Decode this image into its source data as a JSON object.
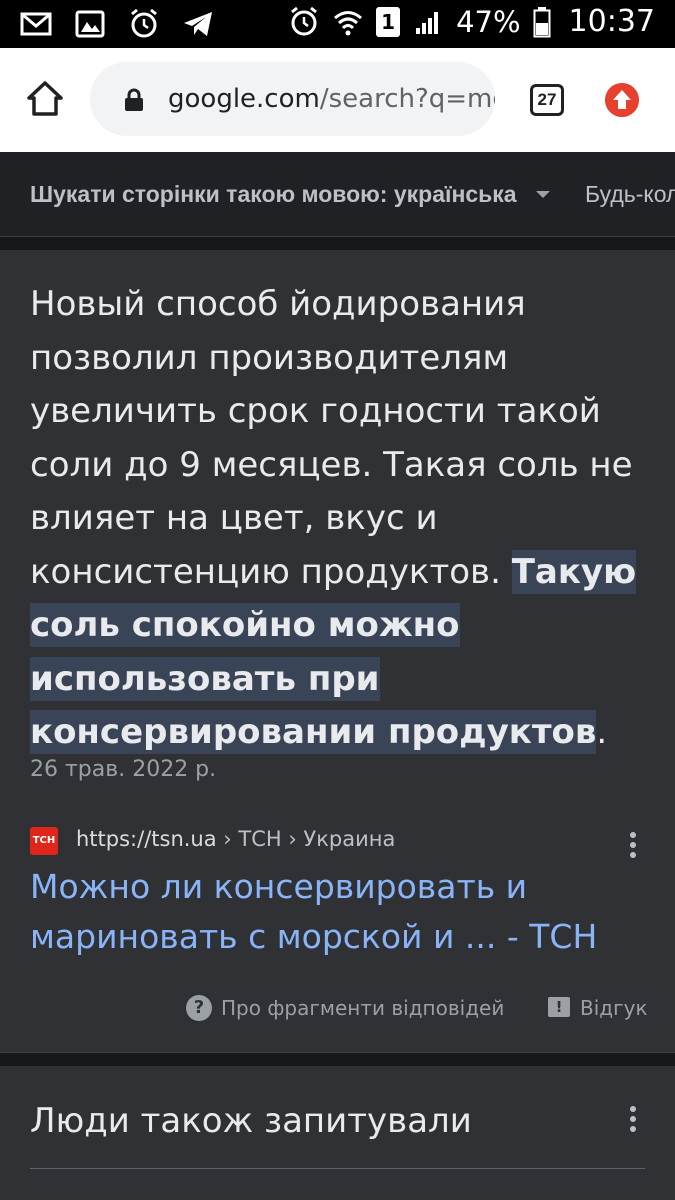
{
  "status_bar": {
    "icons_left": [
      "gmail-icon",
      "gallery-icon",
      "alarm-icon",
      "telegram-icon"
    ],
    "sim_slot": "1",
    "battery_percent": "47%",
    "time": "10:37"
  },
  "browser": {
    "url_host": "google.com",
    "url_rest": "/search?q=mo:",
    "tab_count": "27"
  },
  "language_bar": {
    "language_filter": "Шукати сторінки такою мовою: українська",
    "any_time": "Будь-коли"
  },
  "featured_snippet": {
    "text_plain": "Новый способ йодирования позволил производителям увеличить срок годности такой соли до 9 месяцев. Такая соль не влияет на цвет, вкус и консистенцию продуктов. ",
    "text_highlight": "Такую соль спокойно можно использовать при консервировании продуктов",
    "text_tail": ".",
    "date": "26 трав. 2022 р.",
    "source_logo_text": "ТСН",
    "source_url": "https://tsn.ua",
    "source_breadcrumb": " › ТСН › Украина",
    "link_title": "Можно ли консервировать и мариновать с морской и ... - ТСН",
    "about_snippets": "Про фрагменти відповідей",
    "feedback": "Відгук"
  },
  "people_also_ask": {
    "title": "Люди також запитували"
  }
}
